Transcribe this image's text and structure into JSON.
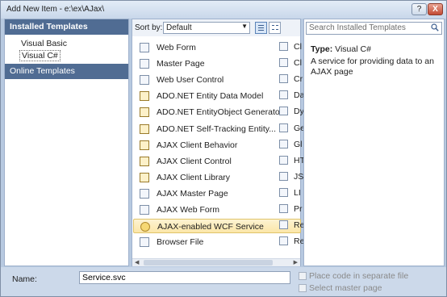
{
  "window": {
    "title": "Add New Item - e:\\ex\\AJax\\",
    "help_label": "?",
    "close_label": "X"
  },
  "left_pane": {
    "installed_templates": "Installed Templates",
    "items": [
      "Visual Basic",
      "Visual C#"
    ],
    "online_templates": "Online Templates"
  },
  "toolbar": {
    "sort_label": "Sort by:",
    "sort_value": "Default"
  },
  "templates": [
    {
      "label": "Web Form",
      "icon": "page-icon"
    },
    {
      "label": "Master Page",
      "icon": "master-page-icon"
    },
    {
      "label": "Web User Control",
      "icon": "user-control-icon"
    },
    {
      "label": "ADO.NET Entity Data Model",
      "icon": "entity-icon"
    },
    {
      "label": "ADO.NET EntityObject Generator",
      "icon": "entity-icon"
    },
    {
      "label": "ADO.NET Self-Tracking Entity...",
      "icon": "entity-icon"
    },
    {
      "label": "AJAX Client Behavior",
      "icon": "js-file-icon"
    },
    {
      "label": "AJAX Client Control",
      "icon": "js-file-icon"
    },
    {
      "label": "AJAX Client Library",
      "icon": "js-file-icon"
    },
    {
      "label": "AJAX Master Page",
      "icon": "master-page-icon"
    },
    {
      "label": "AJAX Web Form",
      "icon": "page-icon"
    },
    {
      "label": "AJAX-enabled WCF Service",
      "icon": "service-icon"
    },
    {
      "label": "Browser File",
      "icon": "file-icon"
    }
  ],
  "selected_template_index": 11,
  "second_column": [
    {
      "label": "Cl",
      "icon": "class-icon"
    },
    {
      "label": "Cl",
      "icon": "class-diagram-icon"
    },
    {
      "label": "Cr",
      "icon": "crystal-icon"
    },
    {
      "label": "Da",
      "icon": "dataset-icon"
    },
    {
      "label": "Dy",
      "icon": "dynamic-data-icon"
    },
    {
      "label": "Ge",
      "icon": "generic-handler-icon"
    },
    {
      "label": "Gl",
      "icon": "global-icon"
    },
    {
      "label": "HT",
      "icon": "html-icon"
    },
    {
      "label": "JS",
      "icon": "js-file-icon"
    },
    {
      "label": "LI",
      "icon": "linq-icon"
    },
    {
      "label": "Pr",
      "icon": "preprocessed-icon"
    },
    {
      "label": "Re",
      "icon": "report-icon"
    },
    {
      "label": "Re",
      "icon": "resource-icon"
    }
  ],
  "right_pane": {
    "search_placeholder": "Search Installed Templates",
    "type_label": "Type:",
    "type_value": "Visual C#",
    "description": "A service for providing data to an AJAX page"
  },
  "bottom": {
    "name_label": "Name:",
    "name_value": "Service.svc",
    "checkbox1": "Place code in separate file",
    "checkbox2": "Select master page"
  }
}
